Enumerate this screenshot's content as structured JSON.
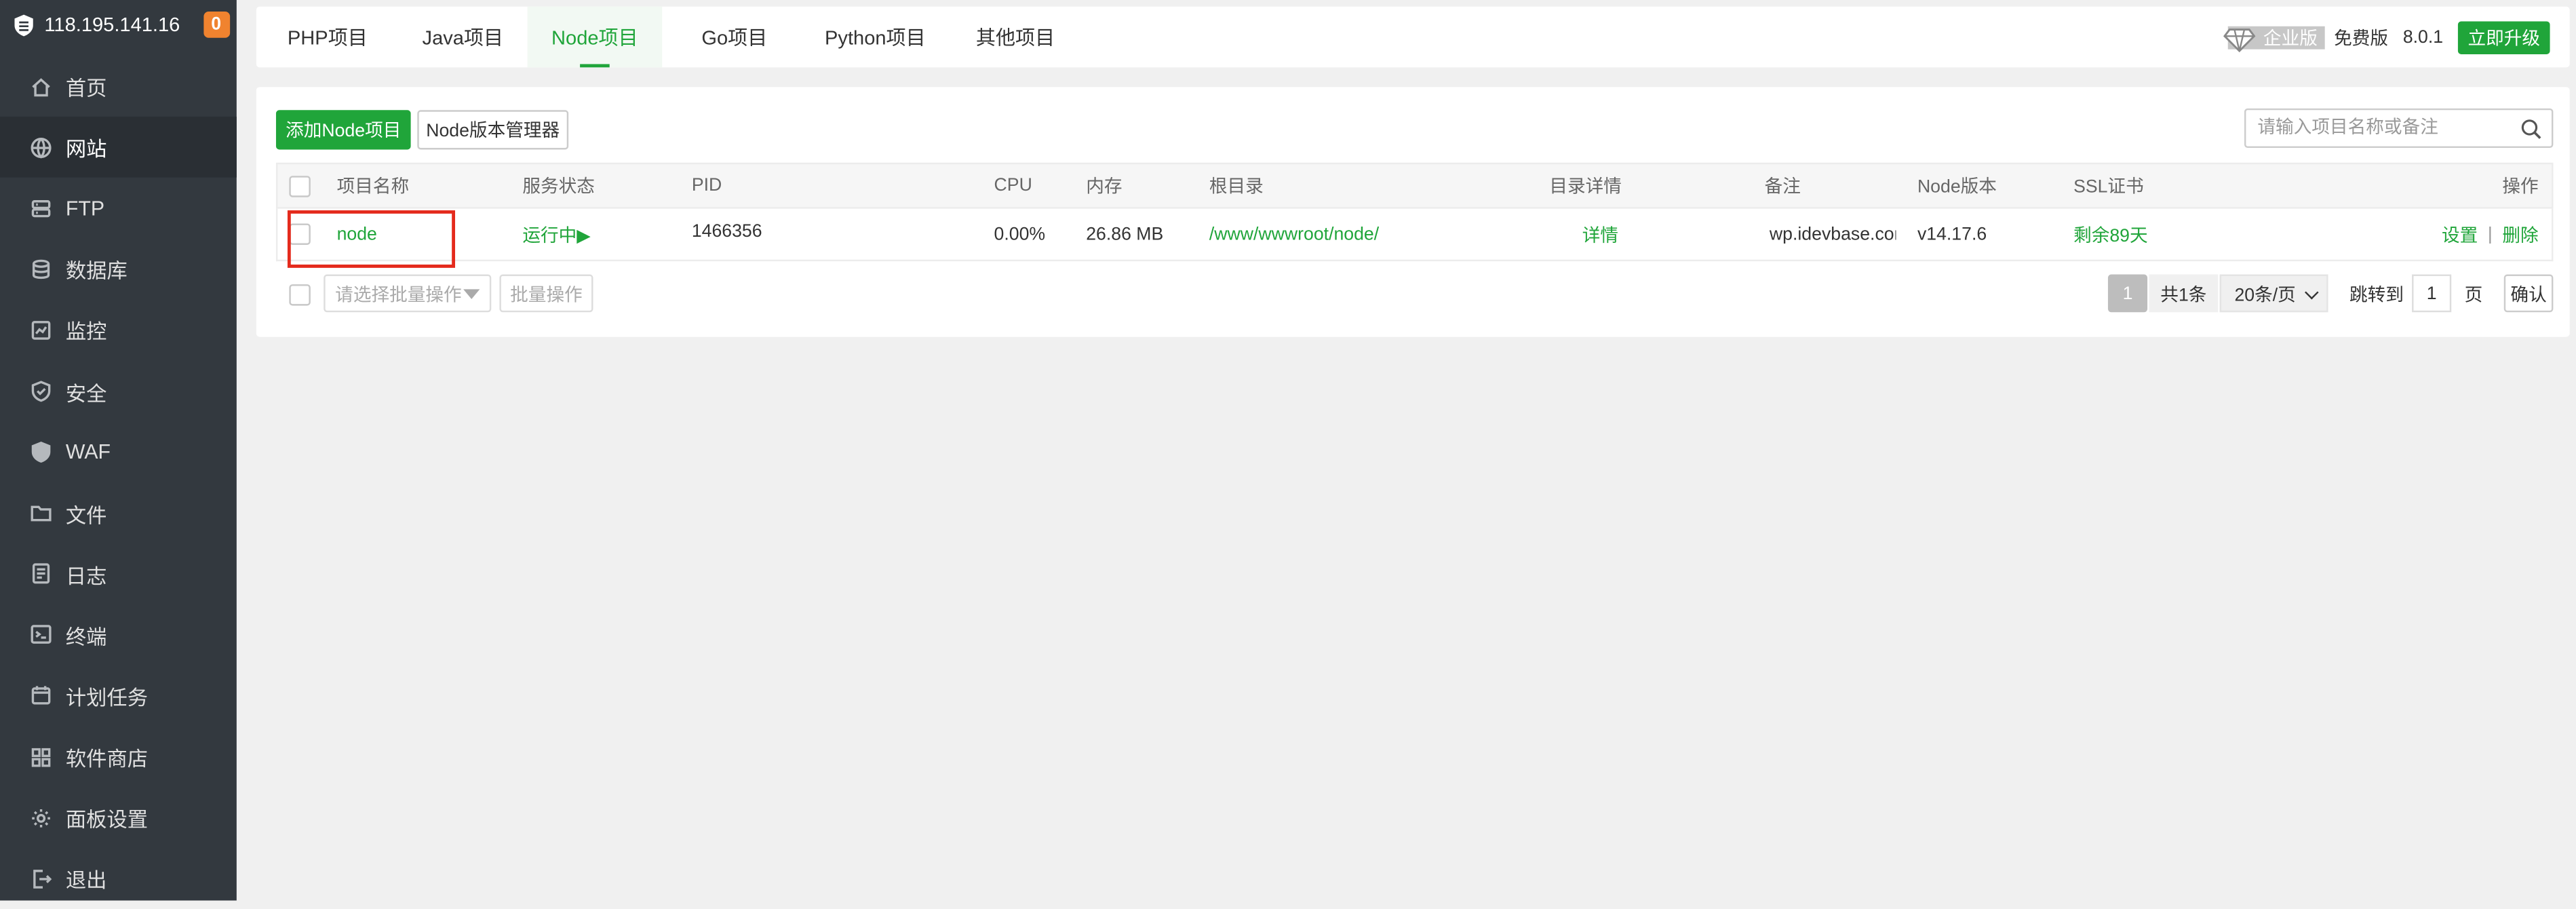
{
  "sidebar": {
    "server_ip": "118.195.141.16",
    "badge": "0",
    "items": [
      {
        "label": "首页",
        "icon": "home-icon"
      },
      {
        "label": "网站",
        "icon": "globe-icon"
      },
      {
        "label": "FTP",
        "icon": "ftp-icon"
      },
      {
        "label": "数据库",
        "icon": "database-icon"
      },
      {
        "label": "监控",
        "icon": "monitor-icon"
      },
      {
        "label": "安全",
        "icon": "shield-icon"
      },
      {
        "label": "WAF",
        "icon": "waf-shield-icon"
      },
      {
        "label": "文件",
        "icon": "folder-icon"
      },
      {
        "label": "日志",
        "icon": "log-icon"
      },
      {
        "label": "终端",
        "icon": "terminal-icon"
      },
      {
        "label": "计划任务",
        "icon": "calendar-icon"
      },
      {
        "label": "软件商店",
        "icon": "grid-icon"
      },
      {
        "label": "面板设置",
        "icon": "gear-icon"
      },
      {
        "label": "退出",
        "icon": "logout-icon"
      }
    ],
    "active_index": 1
  },
  "tabs": [
    {
      "label": "PHP项目"
    },
    {
      "label": "Java项目"
    },
    {
      "label": "Node项目"
    },
    {
      "label": "Go项目"
    },
    {
      "label": "Python项目"
    },
    {
      "label": "其他项目"
    }
  ],
  "active_tab": 2,
  "version": {
    "enterprise": "企业版",
    "free": "免费版",
    "number": "8.0.1",
    "upgrade": "立即升级"
  },
  "toolbar": {
    "add_label": "添加Node项目",
    "version_manager": "Node版本管理器",
    "search_placeholder": "请输入项目名称或备注"
  },
  "table": {
    "headers": {
      "name": "项目名称",
      "status": "服务状态",
      "pid": "PID",
      "cpu": "CPU",
      "mem": "内存",
      "root": "根目录",
      "detail": "目录详情",
      "note": "备注",
      "node_ver": "Node版本",
      "ssl": "SSL证书",
      "ops": "操作"
    },
    "rows": [
      {
        "name": "node",
        "status": "运行中▶",
        "pid": "1466356",
        "cpu": "0.00%",
        "mem": "26.86 MB",
        "root": "/www/wwwroot/node/",
        "detail": "详情",
        "note": "wp.idevbase.com",
        "node_ver": "v14.17.6",
        "ssl": "剩余89天",
        "op_settings": "设置",
        "op_sep": "|",
        "op_delete": "删除"
      }
    ]
  },
  "footer": {
    "batch_placeholder": "请选择批量操作",
    "batch_button": "批量操作",
    "page_current": "1",
    "page_total": "共1条",
    "page_size": "20条/页",
    "jump_label": "跳转到",
    "jump_value": "1",
    "page_unit": "页",
    "confirm": "确认"
  },
  "colors": {
    "accent": "#20a53a",
    "sidebar_bg": "#33393f",
    "highlight": "#e42a1c"
  }
}
